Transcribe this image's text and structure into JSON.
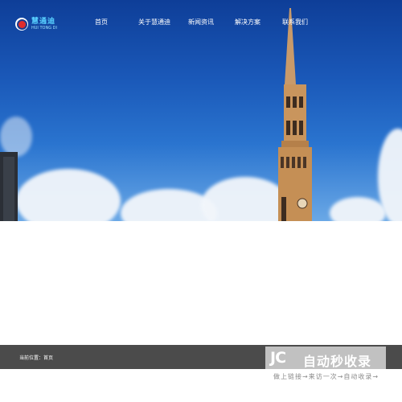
{
  "header": {
    "logo_text": "慧通迪",
    "logo_sub": "HUI TONG DI",
    "nav": [
      {
        "label": "首页"
      },
      {
        "label": "关于慧通迪"
      },
      {
        "label": "新闻资讯"
      },
      {
        "label": "解决方案"
      },
      {
        "label": "联系我们"
      }
    ]
  },
  "breadcrumb": {
    "text": "当前位置：首页"
  },
  "watermark": {
    "mark": "JC",
    "title": "自动秒收录",
    "subtitle": "做上链接→来访一次→自动收录→"
  },
  "colors": {
    "nav_text": "#ffffff",
    "breadcrumb_bg": "#4b4b4b",
    "logo_blue": "#58d0ff"
  }
}
